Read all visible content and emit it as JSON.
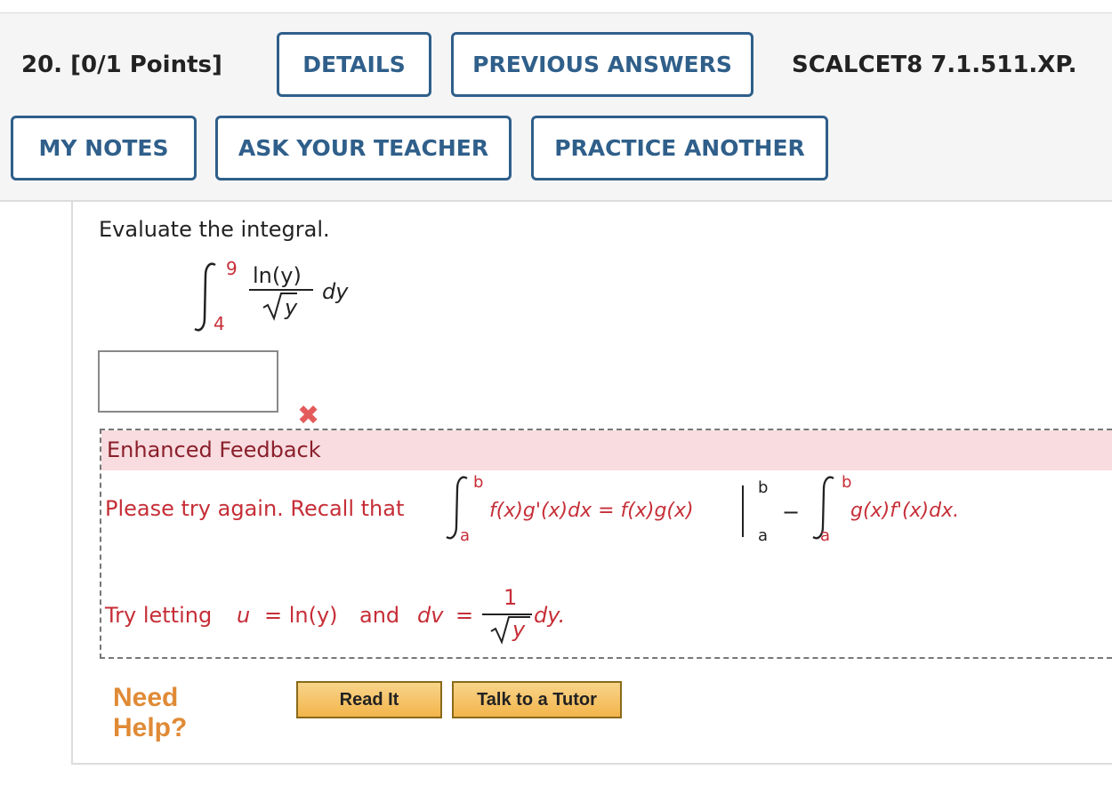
{
  "question": {
    "number": "20.",
    "points": "[0/1 Points]",
    "code": "SCALCET8 7.1.511.XP."
  },
  "buttons": {
    "details": "DETAILS",
    "previous_answers": "PREVIOUS ANSWERS",
    "my_notes": "MY NOTES",
    "ask_teacher": "ASK YOUR TEACHER",
    "practice_another": "PRACTICE ANOTHER"
  },
  "problem": {
    "prompt": "Evaluate the integral.",
    "upper_limit": "9",
    "lower_limit": "4",
    "numerator": "ln(y)",
    "denominator": "y",
    "differential": "dy"
  },
  "answer": {
    "value": "",
    "status": "incorrect"
  },
  "feedback": {
    "title": "Enhanced Feedback",
    "line1_prefix": "Please try again. Recall that",
    "formula_lower": "a",
    "formula_upper": "b",
    "formula_left": "f(x)g'(x)dx = f(x)g(x)",
    "formula_minus": "−",
    "formula_right": "g(x)f'(x)dx.",
    "line2_prefix": "Try letting",
    "u_label": "u",
    "u_value": "= ln(y)",
    "and": "and",
    "dv_label": "dv",
    "eq": "=",
    "frac_num": "1",
    "frac_den": "y",
    "frac_suffix": "dy."
  },
  "help": {
    "label": "Need Help?",
    "read_it": "Read It",
    "talk_tutor": "Talk to a Tutor"
  },
  "colors": {
    "button_border": "#2f5f8a",
    "feedback_bg": "#f8dcdf",
    "feedback_text": "#c62e37",
    "need_help": "#e08a36",
    "xmark": "#e45b5b"
  }
}
